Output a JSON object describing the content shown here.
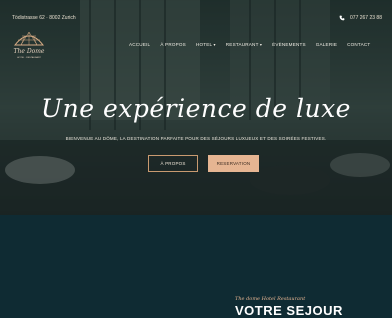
{
  "topbar": {
    "address": "Tödistrasse 62 · 8002 Zurich",
    "phone": "077 267 23 88",
    "phone_icon": "phone-icon"
  },
  "logo": {
    "name": "The Dome",
    "subtitle": "HOTEL · RESTAURANT"
  },
  "nav": [
    {
      "label": "ACCUEIL",
      "dropdown": false
    },
    {
      "label": "À PROPOS",
      "dropdown": false
    },
    {
      "label": "HOTEL",
      "dropdown": true
    },
    {
      "label": "RESTAURANT",
      "dropdown": true
    },
    {
      "label": "ÉVÈNEMENTS",
      "dropdown": false
    },
    {
      "label": "GALERIE",
      "dropdown": false
    },
    {
      "label": "CONTACT",
      "dropdown": false
    }
  ],
  "hero": {
    "title": "Une expérience de luxe",
    "subtitle": "BIENVENUE AU DÔME, LA DESTINATION PARFAITE POUR DES SÉJOURS LUXUEUX ET DES SOIRÉES FESTIVES.",
    "btn_about": "À PROPOS",
    "btn_reserve": "RESERVATION"
  },
  "section": {
    "tagline": "The dome Hotel Restaurant",
    "title": "VOTRE SEJOUR"
  },
  "colors": {
    "accent": "#e6b592",
    "dark": "#0f2b33"
  }
}
